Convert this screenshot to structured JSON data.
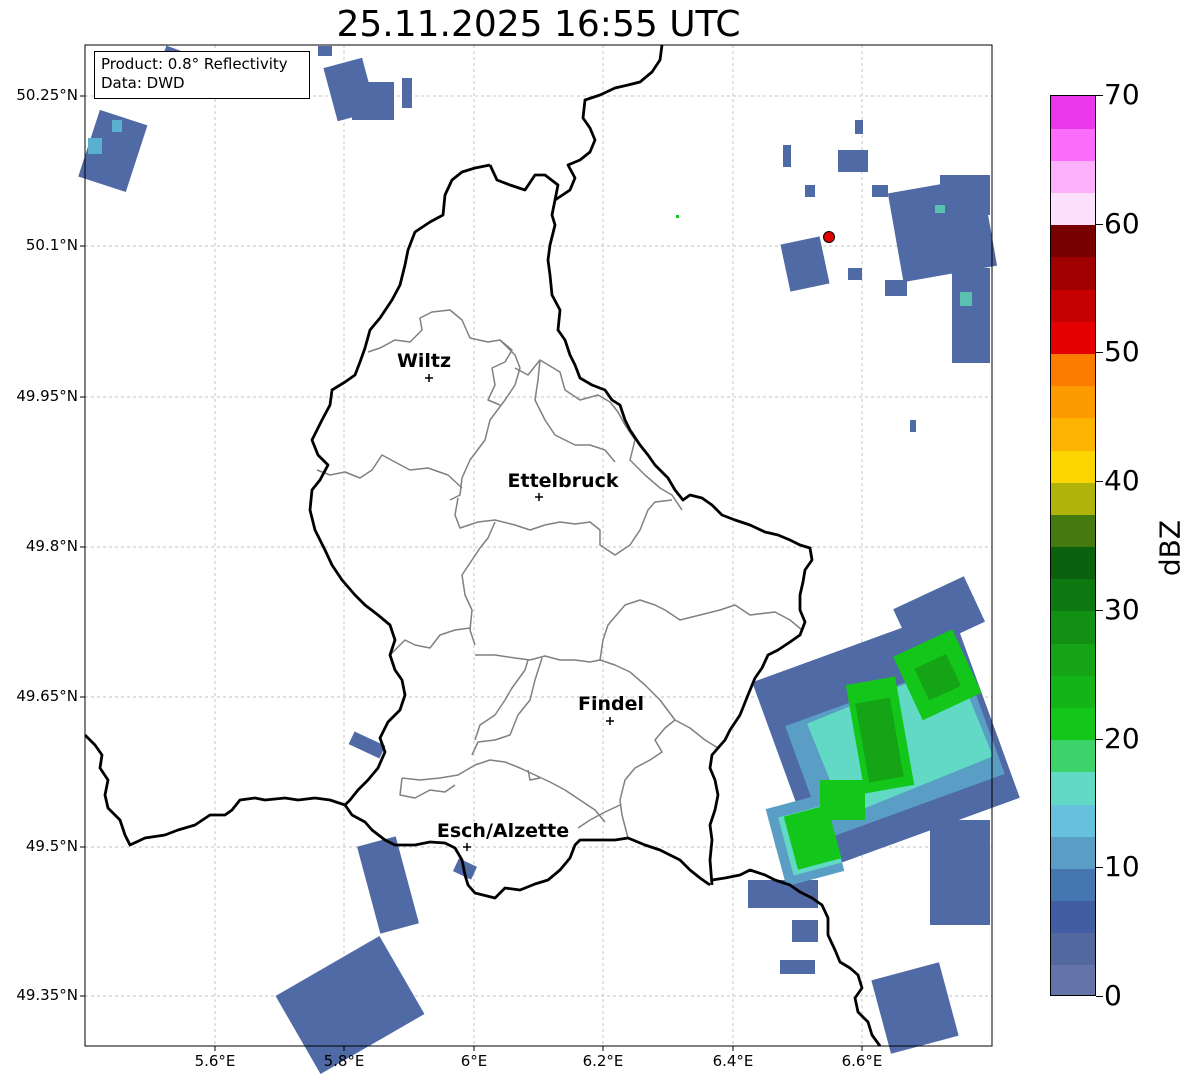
{
  "title": "25.11.2025 16:55 UTC",
  "info_box": {
    "product": "Product: 0.8° Reflectivity",
    "data": "Data: DWD"
  },
  "lat_ticks": [
    "50.25°N",
    "50.1°N",
    "49.95°N",
    "49.8°N",
    "49.65°N",
    "49.5°N",
    "49.35°N"
  ],
  "lon_ticks": [
    "5.6°E",
    "5.8°E",
    "6°E",
    "6.2°E",
    "6.4°E",
    "6.6°E"
  ],
  "cities": [
    {
      "name": "Wiltz"
    },
    {
      "name": "Ettelbruck"
    },
    {
      "name": "Findel"
    },
    {
      "name": "Esch/Alzette"
    }
  ],
  "colorbar": {
    "label": "dBZ",
    "ticks": [
      "0",
      "10",
      "20",
      "30",
      "40",
      "50",
      "60",
      "70"
    ],
    "min": 0,
    "max": 70,
    "colors": [
      "#6474a8",
      "#52689f",
      "#425ea2",
      "#4676b0",
      "#5a9ec6",
      "#66c1dc",
      "#62d9c4",
      "#3cd46a",
      "#12c61a",
      "#12b418",
      "#14a416",
      "#119014",
      "#0c7810",
      "#0b620e",
      "#457a10",
      "#b0b40a",
      "#fcd600",
      "#fcb400",
      "#fc9a00",
      "#fc7c00",
      "#e40000",
      "#c40000",
      "#a00000",
      "#780000",
      "#fde0fc",
      "#fcb0fc",
      "#fc6cfc",
      "#ec36ec"
    ]
  },
  "radar_marker_color": "#e00000",
  "map_colors": {
    "country_border": "#000000",
    "canton_border": "#808080",
    "grid": "#b0b0b0"
  }
}
